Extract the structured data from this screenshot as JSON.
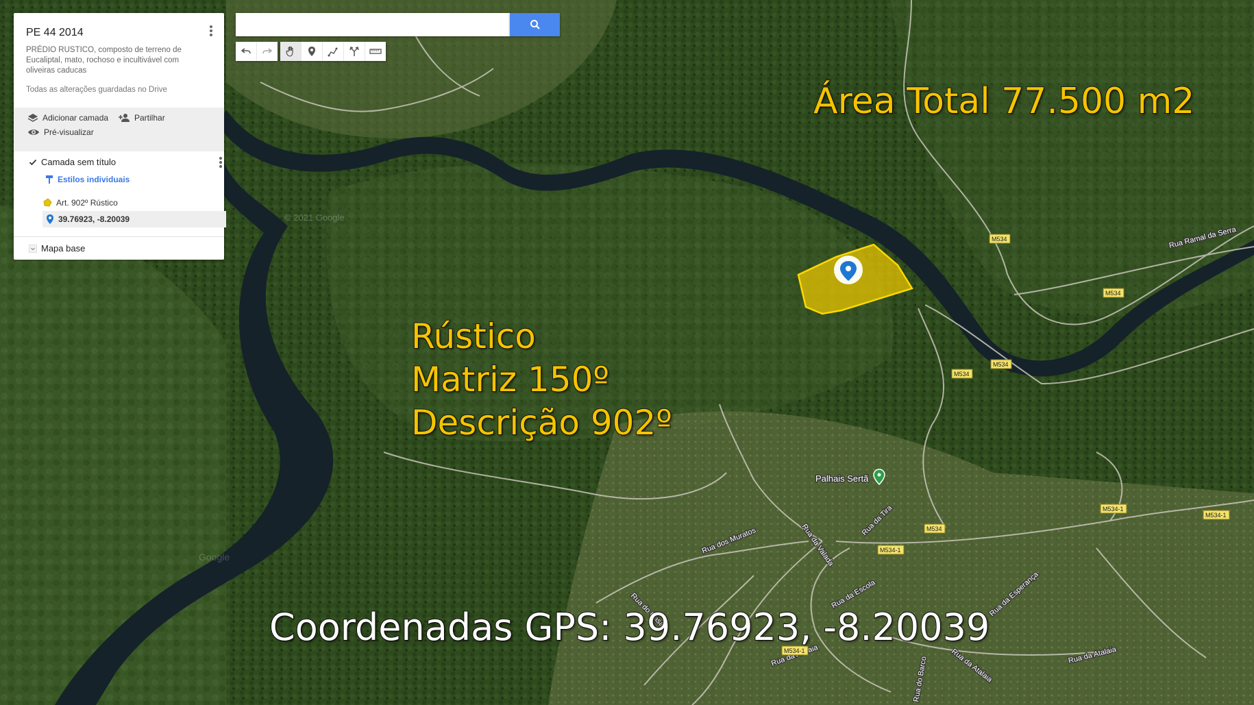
{
  "panel": {
    "title": "PE 44 2014",
    "description": "PRÉDIO RUSTICO, composto de terreno de Eucaliptal, mato, rochoso e incultivável com oliveiras caducas",
    "saved_status": "Todas as alterações guardadas no Drive",
    "add_layer": "Adicionar camada",
    "share": "Partilhar",
    "preview": "Pré-visualizar",
    "layer_name": "Camada sem título",
    "layer_style": "Estilos individuais",
    "feature_polygon": "Art. 902º Rústico",
    "feature_marker": "39.76923, -8.20039",
    "base_map": "Mapa base"
  },
  "search": {
    "value": "",
    "placeholder": ""
  },
  "toolbar": {
    "tools": [
      "undo-icon",
      "redo-icon",
      "hand-icon",
      "add-marker-icon",
      "draw-line-icon",
      "directions-icon",
      "ruler-icon"
    ]
  },
  "overlays": {
    "area_total": "Área Total 77.500 m2",
    "rustico": "Rústico",
    "matriz": "Matriz 150º",
    "descricao": "Descrição 902º",
    "gps": "Coordenadas GPS: 39.76923, -8.20039"
  },
  "map_labels": {
    "place": "Palhais Sertã",
    "copyright": "© 2021 Google",
    "watermark": "Google",
    "roads": [
      "Rua Ramal da Serra",
      "Rua dos Muratos",
      "Rua da Valada",
      "Rua da Tira",
      "Rua da Escola",
      "Rua da Esperança",
      "Rua do Casal",
      "Rua da Atalaia",
      "Rua da Atalaia",
      "Rua da Atalaia",
      "Rua do Barco"
    ],
    "shields": [
      "M534",
      "M534",
      "M534",
      "M534",
      "M534",
      "M534-1",
      "M534-1",
      "M534-1",
      "M534-1"
    ]
  },
  "colors": {
    "polygon_fill": "#e8c400",
    "overlay_yellow": "#f5c400",
    "search_button": "#4a87ee",
    "marker_blue": "#1e78d2",
    "place_green": "#2e9e4a"
  }
}
